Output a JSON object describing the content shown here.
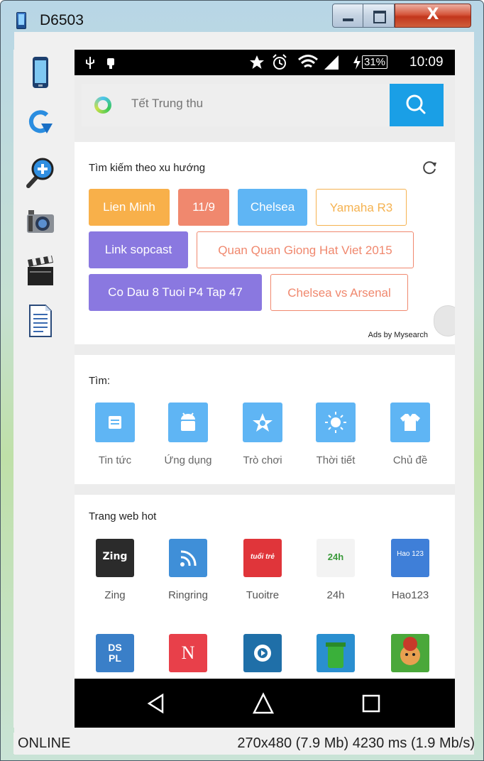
{
  "window": {
    "title": "D6503",
    "close_glyph": "X"
  },
  "toolbar": {
    "tools": [
      "phone-icon",
      "rotate-icon",
      "zoom-in-icon",
      "camera-icon",
      "clapperboard-icon",
      "document-icon"
    ]
  },
  "statusbar": {
    "battery": "31%",
    "time": "10:09"
  },
  "search": {
    "placeholder": "Tết Trung thu"
  },
  "trending": {
    "title": "Tìm kiếm theo xu hướng",
    "tags": [
      {
        "label": "Lien Minh",
        "style": "solid",
        "color": "#f8b04a"
      },
      {
        "label": "11/9",
        "style": "solid",
        "color": "#f0886e"
      },
      {
        "label": "Chelsea",
        "style": "solid",
        "color": "#5fb5f4"
      },
      {
        "label": "Yamaha R3",
        "style": "outline",
        "color": "#f5b250"
      },
      {
        "label": "Link sopcast",
        "style": "solid",
        "color": "#8a78e0"
      },
      {
        "label": "Quan Quan Giong Hat Viet 2015",
        "style": "outline",
        "color": "#f0886e"
      },
      {
        "label": "Co Dau 8 Tuoi P4 Tap 47",
        "style": "solid",
        "color": "#8a78e0"
      },
      {
        "label": "Chelsea vs Arsenal",
        "style": "outline",
        "color": "#f0886e"
      }
    ],
    "ads": "Ads by Mysearch"
  },
  "find": {
    "title": "Tìm:",
    "items": [
      {
        "label": "Tin tức",
        "icon": "news-icon"
      },
      {
        "label": "Ứng dụng",
        "icon": "android-icon"
      },
      {
        "label": "Trò chơi",
        "icon": "game-icon"
      },
      {
        "label": "Thời tiết",
        "icon": "sun-icon"
      },
      {
        "label": "Chủ đề",
        "icon": "tshirt-icon"
      }
    ]
  },
  "hot_sites": {
    "title": "Trang web hot",
    "items": [
      {
        "label": "Zing",
        "icon_text": "Zing",
        "color": "#2b2b2b"
      },
      {
        "label": "Ringring",
        "icon_text": "",
        "color": "#3f8fd8"
      },
      {
        "label": "Tuoitre",
        "icon_text": "tuổi trẻ",
        "color": "#e0353a"
      },
      {
        "label": "24h",
        "icon_text": "24h",
        "color": "#f3f3f3"
      },
      {
        "label": "Hao123",
        "icon_text": "Hao 123",
        "color": "#3f7fd8"
      }
    ],
    "row2": [
      {
        "icon_text": "DS PL",
        "color": "#3a7fc8"
      },
      {
        "icon_text": "N",
        "color": "#e8404a"
      },
      {
        "icon_text": "",
        "color": "#1f6fa8"
      },
      {
        "icon_text": "",
        "color": "#2a8fd0"
      },
      {
        "icon_text": "",
        "color": "#4aa83a"
      }
    ]
  },
  "bottom": {
    "status": "ONLINE",
    "info": "270x480 (7.9 Mb)  4230 ms (1.9 Mb/s)"
  }
}
